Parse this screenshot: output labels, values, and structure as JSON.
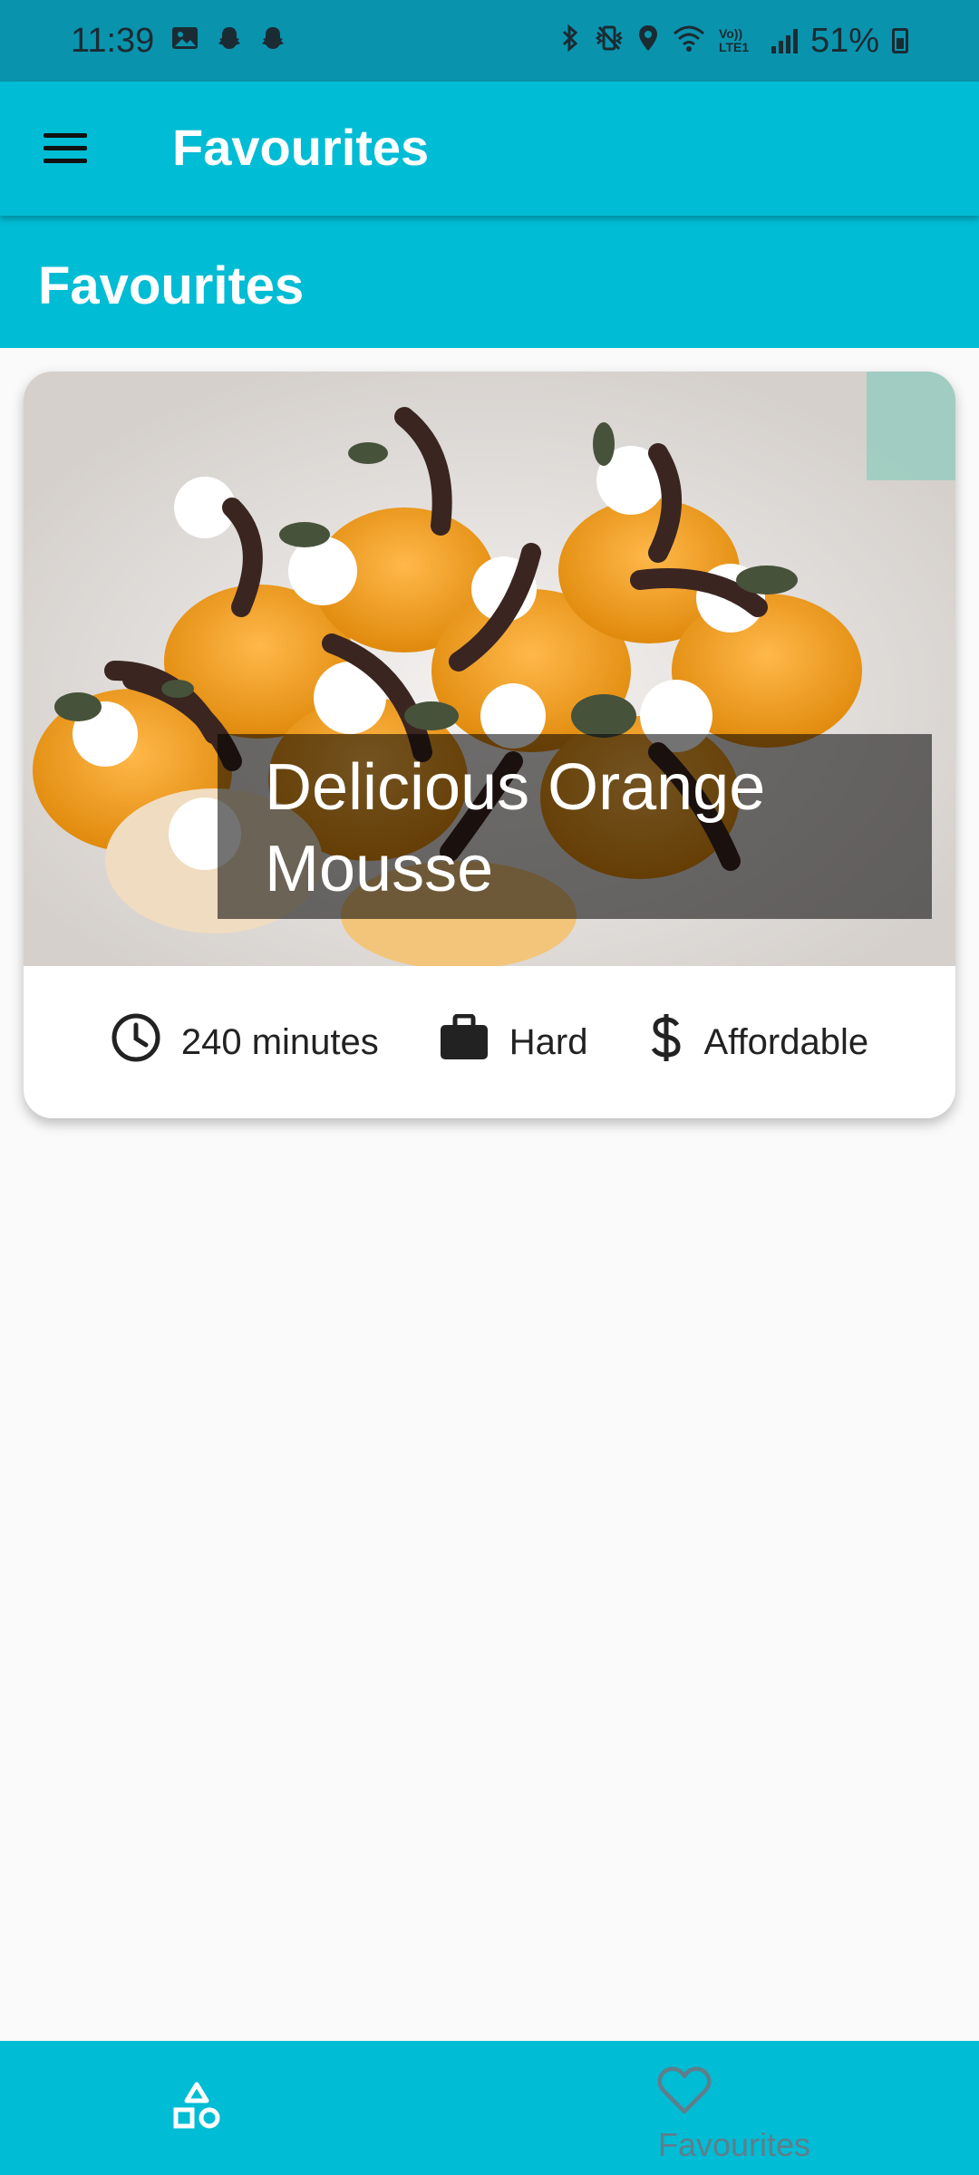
{
  "status_bar": {
    "time": "11:39",
    "battery_percent": "51%",
    "lte_label": "Vo)) LTE1",
    "icons": [
      "gallery-icon",
      "snapchat-icon",
      "snapchat-icon",
      "bluetooth-icon",
      "vibrate-icon",
      "location-icon",
      "wifi-icon",
      "signal-icon",
      "battery-icon"
    ]
  },
  "app_bar": {
    "title": "Favourites",
    "menu_icon": "hamburger-menu-icon"
  },
  "section": {
    "title": "Favourites"
  },
  "meal_card": {
    "title": "Delicious Orange Mousse",
    "duration": "240 minutes",
    "complexity": "Hard",
    "affordability": "Affordable",
    "icons": {
      "duration": "clock-icon",
      "complexity": "briefcase-icon",
      "affordability": "dollar-icon"
    }
  },
  "bottom_nav": {
    "items": [
      {
        "label": "",
        "icon": "categories-shapes-icon"
      },
      {
        "label": "Favourites",
        "icon": "heart-outline-icon"
      }
    ]
  },
  "colors": {
    "primary": "#00BCD4",
    "status_bar": "#0A93AD",
    "background": "#FAFAFA",
    "overlay": "rgba(0,0,0,0.55)",
    "nav_label": "#607D8B"
  }
}
